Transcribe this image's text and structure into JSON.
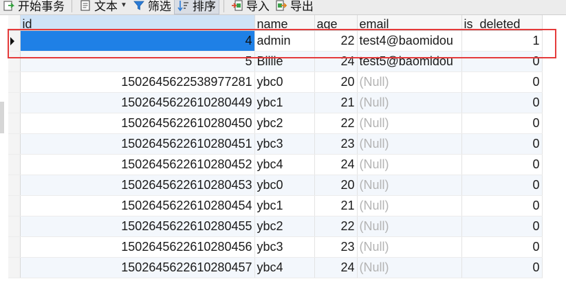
{
  "toolbar": {
    "begin_transaction": "开始事务",
    "text": "文本",
    "filter": "筛选",
    "sort": "排序",
    "import": "导入",
    "export": "导出"
  },
  "table": {
    "columns": [
      "id",
      "name",
      "age",
      "email",
      "is_deleted"
    ],
    "rows": [
      {
        "id": "4",
        "name": "admin",
        "age": "22",
        "email": "test4@baomidou",
        "is_deleted": "1",
        "email_null": false
      },
      {
        "id": "5",
        "name": "Billie",
        "age": "24",
        "email": "test5@baomidou",
        "is_deleted": "0",
        "email_null": false
      },
      {
        "id": "1502645622538977281",
        "name": "ybc0",
        "age": "20",
        "email": "(Null)",
        "is_deleted": "0",
        "email_null": true
      },
      {
        "id": "1502645622610280449",
        "name": "ybc1",
        "age": "21",
        "email": "(Null)",
        "is_deleted": "0",
        "email_null": true
      },
      {
        "id": "1502645622610280450",
        "name": "ybc2",
        "age": "22",
        "email": "(Null)",
        "is_deleted": "0",
        "email_null": true
      },
      {
        "id": "1502645622610280451",
        "name": "ybc3",
        "age": "23",
        "email": "(Null)",
        "is_deleted": "0",
        "email_null": true
      },
      {
        "id": "1502645622610280452",
        "name": "ybc4",
        "age": "24",
        "email": "(Null)",
        "is_deleted": "0",
        "email_null": true
      },
      {
        "id": "1502645622610280453",
        "name": "ybc0",
        "age": "20",
        "email": "(Null)",
        "is_deleted": "0",
        "email_null": true
      },
      {
        "id": "1502645622610280454",
        "name": "ybc1",
        "age": "21",
        "email": "(Null)",
        "is_deleted": "0",
        "email_null": true
      },
      {
        "id": "1502645622610280455",
        "name": "ybc2",
        "age": "22",
        "email": "(Null)",
        "is_deleted": "0",
        "email_null": true
      },
      {
        "id": "1502645622610280456",
        "name": "ybc3",
        "age": "23",
        "email": "(Null)",
        "is_deleted": "0",
        "email_null": true
      },
      {
        "id": "1502645622610280457",
        "name": "ybc4",
        "age": "24",
        "email": "(Null)",
        "is_deleted": "0",
        "email_null": true
      }
    ]
  },
  "colors": {
    "selected_cell": "#1f80e6",
    "highlight_box": "#e53a3a",
    "null_text": "#b3b3b3",
    "alt_row": "#f3f7fc"
  }
}
